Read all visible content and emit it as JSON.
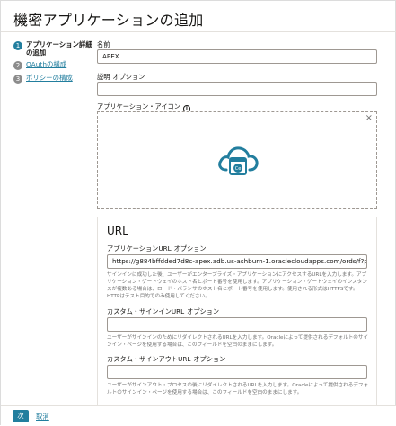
{
  "dialog": {
    "title": "機密アプリケーションの追加"
  },
  "steps": [
    {
      "num": "1",
      "label": "アプリケーション詳細の追加"
    },
    {
      "num": "2",
      "label": "OAuthの構成"
    },
    {
      "num": "3",
      "label": "ポリシーの構成"
    }
  ],
  "form": {
    "name_label": "名前",
    "name_value": "APEX",
    "description_label": "説明",
    "description_optional": "オプション",
    "description_value": "",
    "icon_label": "アプリケーション・アイコン",
    "info_icon": "i",
    "close_icon": "×",
    "icon_badge": "Ce"
  },
  "url_section": {
    "heading": "URL",
    "app_url_label": "アプリケーションURL",
    "app_url_optional": "オプション",
    "app_url_value": "https://g884bffdded7d8c-apex.adb.us-ashburn-1.oraclecloudapps.com/ords/f?p=100",
    "app_url_help": "サインインに成功した後、ユーザーがエンタープライズ・アプリケーションにアクセスするURLを入力します。アプリケーション・ゲートウェイのホスト名とポート番号を使用します。アプリケーション・ゲートウェイのインスタンスが複数ある場合は、ロード・バランサのホスト名とポート番号を使用します。使用される形式はHTTPSです。HTTPはテスト目的でのみ使用してください。",
    "signin_label": "カスタム・サインインURL",
    "signin_optional": "オプション",
    "signin_value": "",
    "signin_help": "ユーザーがサインインのためにリダイレクトされるURLを入力します。Oracleによって提供されるデフォルトのサインイン・ページを使用する場合は、このフィールドを空白のままにします。",
    "signout_label": "カスタム・サインアウトURL",
    "signout_optional": "オプション",
    "signout_value": "",
    "signout_help": "ユーザーがサインアウト・プロセスの後にリダイレクトされるURLを入力します。Oracleによって提供されるデフォルトのサインイン・ページを使用する場合は、このフィールドを空白のままにします。"
  },
  "footer": {
    "next_label": "次",
    "cancel_label": "取消"
  },
  "colors": {
    "accent": "#227e9e",
    "text": "#161513",
    "muted": "#6f6f6f"
  }
}
